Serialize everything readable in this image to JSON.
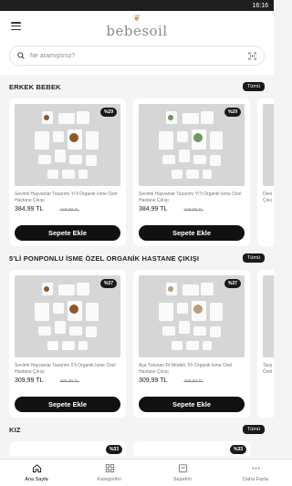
{
  "status_bar": {
    "time": "16:16"
  },
  "header": {
    "logo_text": "bebesoil",
    "logo_mark": "❦"
  },
  "search": {
    "placeholder": "Ne aramıştınız?"
  },
  "sections": [
    {
      "title": "ERKEK BEBEK",
      "all_label": "Tümü",
      "cards": [
        {
          "badge": "%29",
          "name": "Sevimli Hayvanlar Tasarımı Yı'li Organik İsme Özel Hastane Çıkışı",
          "price": "384,99 TL",
          "old_price": "449,99 TL",
          "cart_label": "Sepete Ekle",
          "accent": "#8b5a2b"
        },
        {
          "badge": "%29",
          "name": "Sevimli Hayvanlar Tasarımı Yı'li Organik İsme Özel Hastane Çıkışı",
          "price": "384,99 TL",
          "old_price": "449,99 TL",
          "cart_label": "Sepete Ekle",
          "accent": "#6a9a5b"
        },
        {
          "badge": "",
          "name": "Deniz Çıkış",
          "price": "",
          "old_price": "",
          "cart_label": "",
          "accent": ""
        }
      ]
    },
    {
      "title": "5'Lİ PONPONLU İSME ÖZEL ORGANİK HASTANE ÇIKIŞI",
      "all_label": "Tümü",
      "cards": [
        {
          "badge": "%37",
          "name": "Sevimli Hayvanlar Tasarımı 5'li Organik İsme Özel Hastane Çıkışı",
          "price": "309,99 TL",
          "old_price": "489,99 TL",
          "cart_label": "Sepete Ekle",
          "accent": "#8b5a2b"
        },
        {
          "badge": "%37",
          "name": "Aya Tutunan Fil Modeli, 5'li Organik İsme Özel Hastane Çıkışı",
          "price": "309,99 TL",
          "old_price": "489,99 TL",
          "cart_label": "Sepete Ekle",
          "accent": "#b8a07a"
        },
        {
          "badge": "",
          "name": "Tavşı Özel",
          "price": "",
          "old_price": "",
          "cart_label": "",
          "accent": ""
        }
      ]
    },
    {
      "title": "KIZ",
      "all_label": "Tümü",
      "cards": [
        {
          "badge": "%33"
        },
        {
          "badge": "%33"
        }
      ]
    }
  ],
  "bottom_nav": [
    {
      "label": "Ana Sayfa",
      "icon": "home-icon",
      "active": true
    },
    {
      "label": "Kategoriler",
      "icon": "grid-icon",
      "active": false
    },
    {
      "label": "Sepetim",
      "icon": "cart-icon",
      "active": false
    },
    {
      "label": "Daha Fazla",
      "icon": "more-icon",
      "active": false
    }
  ]
}
